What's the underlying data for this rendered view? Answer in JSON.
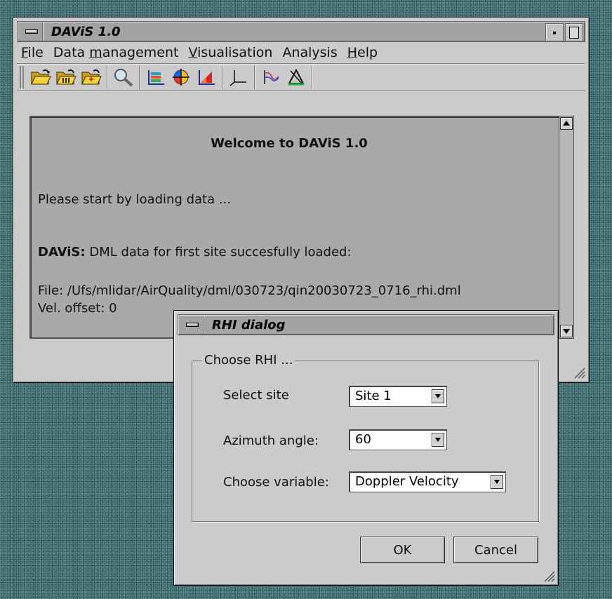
{
  "main_window": {
    "title": "DAViS 1.0",
    "menu": [
      {
        "pre": "",
        "u": "F",
        "post": "ile"
      },
      {
        "pre": "Data ",
        "u": "m",
        "post": "anagement"
      },
      {
        "pre": "",
        "u": "V",
        "post": "isualisation"
      },
      {
        "pre": "Analysis",
        "u": "",
        "post": ""
      },
      {
        "pre": "",
        "u": "H",
        "post": "elp"
      }
    ],
    "toolbar_icons": [
      "open-folder-icon",
      "open-folder-ml-icon",
      "open-folder-add-icon",
      "zoom-icon",
      "ppi-plot-icon",
      "polar-plot-icon",
      "rhi-plot-icon",
      "axes-icon",
      "profile-plot-icon",
      "triangle-plot-icon"
    ],
    "log": {
      "welcome": "Welcome to DAViS 1.0",
      "prompt": "Please start by loading data ...",
      "status_label": "DAViS:",
      "status_text": " DML data for first site succesfully loaded:",
      "file_line": "File: /Ufs/mlidar/AirQuality/dml/030723/qin20030723_0716_rhi.dml",
      "offset_line": "Vel. offset: 0"
    }
  },
  "rhi_dialog": {
    "title": "RHI dialog",
    "group_label": "Choose RHI ...",
    "site_label": "Select site",
    "site_value": "Site 1",
    "azimuth_label": "Azimuth angle:",
    "azimuth_value": "60",
    "variable_label": "Choose variable:",
    "variable_value": "Doppler Velocity",
    "ok_label": "OK",
    "cancel_label": "Cancel"
  }
}
